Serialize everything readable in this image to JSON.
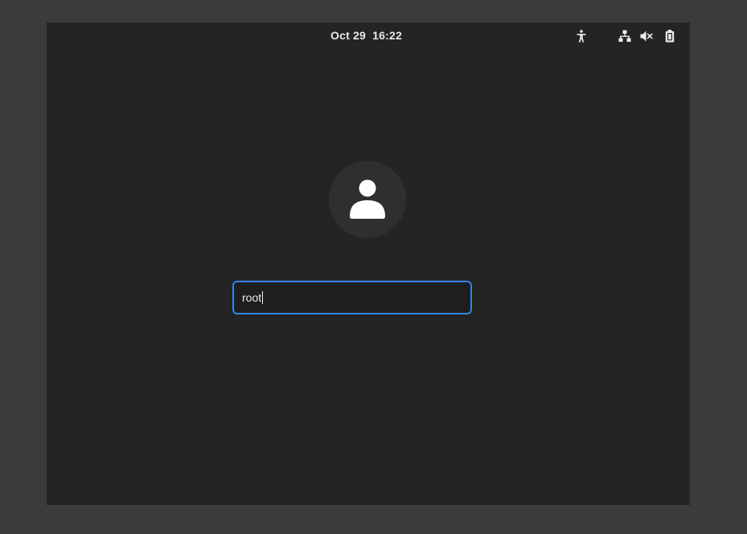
{
  "top_bar": {
    "datetime": "Oct 29  16:22",
    "indicators": [
      {
        "icon": "accessibility-icon"
      },
      {
        "icon": "network-wired-icon"
      },
      {
        "icon": "volume-muted-icon"
      },
      {
        "icon": "battery-icon"
      }
    ]
  },
  "login": {
    "avatar_icon": "user-avatar-icon",
    "username_value": "root"
  },
  "colors": {
    "desktop_bg": "#242424",
    "outer_bg": "#3a3b3d",
    "focus_accent": "#3584e4",
    "text": "#eeeeee"
  }
}
